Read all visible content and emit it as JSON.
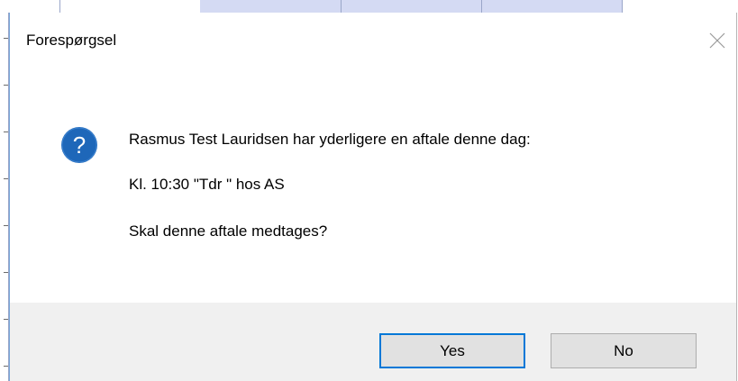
{
  "dialog": {
    "title": "Forespørgsel",
    "message_lines": [
      "Rasmus Test Lauridsen har yderligere en aftale denne dag:",
      "Kl. 10:30 \"Tdr \" hos AS",
      "Skal denne aftale medtages?"
    ],
    "icon": "question-icon",
    "buttons": {
      "yes": "Yes",
      "no": "No"
    },
    "default_button": "yes"
  },
  "colors": {
    "icon_blue": "#1e67b9",
    "default_button_border": "#0078d7",
    "footer_background": "#f0f0f0",
    "background_grid_shade": "#d4daf3"
  }
}
